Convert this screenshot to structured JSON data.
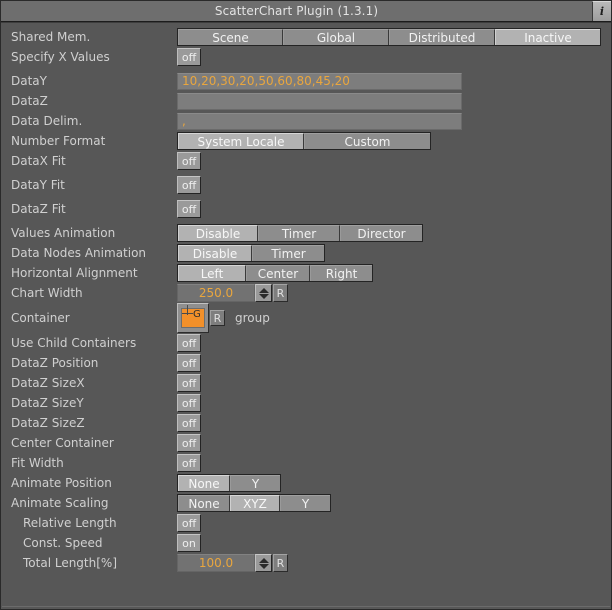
{
  "window": {
    "title": "ScatterChart Plugin (1.3.1)",
    "info_button": "i",
    "accent_orange": "#e9a63e",
    "bg": "#575757"
  },
  "rows": {
    "shared_mem": {
      "label": "Shared Mem.",
      "options": [
        "Scene",
        "Global",
        "Distributed",
        "Inactive"
      ],
      "selected": "Inactive"
    },
    "specify_x_values": {
      "label": "Specify X Values",
      "value": "off"
    },
    "data_y": {
      "label": "DataY",
      "value": "10,20,30,20,50,60,80,45,20",
      "placeholder": ""
    },
    "data_z": {
      "label": "DataZ",
      "value": "",
      "placeholder": ""
    },
    "data_delim": {
      "label": "Data Delim.",
      "value": ",",
      "placeholder": ""
    },
    "number_format": {
      "label": "Number Format",
      "options": [
        "System Locale",
        "Custom"
      ],
      "selected": "System Locale"
    },
    "data_x_fit": {
      "label": "DataX Fit",
      "value": "off"
    },
    "data_y_fit": {
      "label": "DataY Fit",
      "value": "off"
    },
    "data_z_fit": {
      "label": "DataZ Fit",
      "value": "off"
    },
    "values_animation": {
      "label": "Values Animation",
      "options": [
        "Disable",
        "Timer",
        "Director"
      ],
      "selected": "Disable"
    },
    "data_nodes_animation": {
      "label": "Data Nodes Animation",
      "options": [
        "Disable",
        "Timer"
      ],
      "selected": "Disable"
    },
    "horizontal_alignment": {
      "label": "Horizontal Alignment",
      "options": [
        "Left",
        "Center",
        "Right"
      ],
      "selected": "Left"
    },
    "chart_width": {
      "label": "Chart Width",
      "value": "250.0",
      "reset": "R"
    },
    "container": {
      "label": "Container",
      "icon_text": "G",
      "reset": "R",
      "link_name": "group"
    },
    "use_child_containers": {
      "label": "Use Child Containers",
      "value": "off"
    },
    "data_z_position": {
      "label": "DataZ Position",
      "value": "off"
    },
    "data_z_sizex": {
      "label": "DataZ SizeX",
      "value": "off"
    },
    "data_z_sizey": {
      "label": "DataZ SizeY",
      "value": "off"
    },
    "data_z_sizez": {
      "label": "DataZ SizeZ",
      "value": "off"
    },
    "center_container": {
      "label": "Center Container",
      "value": "off"
    },
    "fit_width": {
      "label": "Fit Width",
      "value": "off"
    },
    "animate_position": {
      "label": "Animate Position",
      "options": [
        "None",
        "Y"
      ],
      "selected": "None"
    },
    "animate_scaling": {
      "label": "Animate Scaling",
      "options": [
        "None",
        "XYZ",
        "Y"
      ],
      "selected": "XYZ"
    },
    "relative_length": {
      "label": "Relative Length",
      "value": "off"
    },
    "const_speed": {
      "label": "Const. Speed",
      "value": "on"
    },
    "total_length": {
      "label": "Total Length[%]",
      "value": "100.0",
      "reset": "R"
    }
  }
}
